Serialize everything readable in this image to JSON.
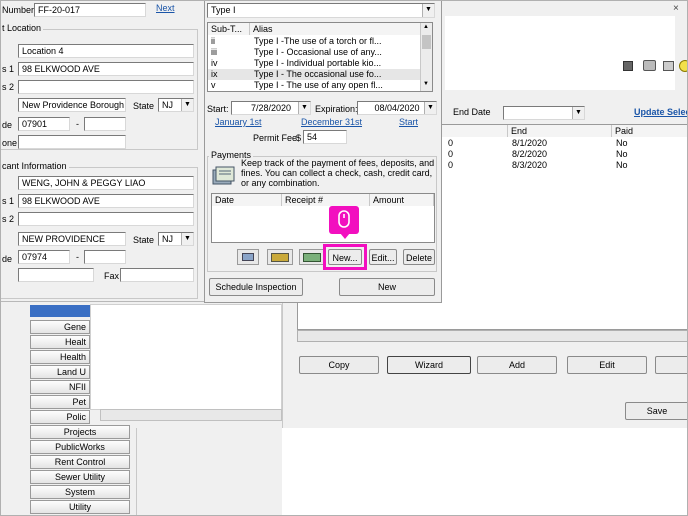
{
  "left_form": {
    "number_label": "Number:",
    "number_value": "FF-20-017",
    "next_link": "Next",
    "location_group": "t Location",
    "location_name": "Location 4",
    "address1_label": "s 1",
    "address1_value": "98 ELKWOOD AVE",
    "address2_label": "s 2",
    "city_value": "New Providence Borough",
    "state_label": "State",
    "state_value": "NJ",
    "zip_label": "de",
    "zip_value": "07901",
    "zip_dash": "-",
    "phone_label": "one",
    "applicant_group": "cant Information",
    "applicant_name": "WENG, JOHN & PEGGY LIAO",
    "app_address1_label": "s 1",
    "app_address1_value": "98 ELKWOOD AVE",
    "app_address2_label": "s 2",
    "app_city_value": "NEW PROVIDENCE",
    "app_state_label": "State",
    "app_state_value": "NJ",
    "app_zip_label": "de",
    "app_zip_value": "07974",
    "app_zip_dash": "-",
    "fax_label": "Fax"
  },
  "permit_panel": {
    "type_value": "Type I",
    "subtype_headers": [
      "Sub-T...",
      "Alias"
    ],
    "subtypes": [
      {
        "code": "ii",
        "alias": "Type I -The use of a torch or fl..."
      },
      {
        "code": "iii",
        "alias": "Type I - Occasional use of any..."
      },
      {
        "code": "iv",
        "alias": "Type I - Individual portable kio..."
      },
      {
        "code": "ix",
        "alias": "Type I - The occasional use fo..."
      },
      {
        "code": "v",
        "alias": "Type I - The use of any open fl..."
      }
    ],
    "start_label": "Start:",
    "start_value": "7/28/2020",
    "expiration_label": "Expiration:",
    "expiration_value": "08/04/2020",
    "link_jan": "January 1st",
    "link_dec": "December 31st",
    "link_start": "Start",
    "permit_fee_label": "Permit Fee",
    "permit_fee_currency": "$",
    "permit_fee_value": "54",
    "payments_title": "Payments",
    "payments_desc": "Keep track of the payment of fees, deposits, and fines. You can collect a check, cash, credit card, or any combination.",
    "payments_headers": [
      "Date",
      "Receipt #",
      "Amount"
    ],
    "new_button": "New...",
    "edit_button": "Edit...",
    "delete_button": "Delete",
    "schedule_button": "Schedule Inspection",
    "new_bottom_button": "New"
  },
  "background_window": {
    "end_date_label": "End Date",
    "update_link": "Update Selec",
    "table_headers": [
      "End",
      "Paid"
    ],
    "rows": [
      {
        "left": "0",
        "end": "8/1/2020",
        "paid": "No"
      },
      {
        "left": "0",
        "end": "8/2/2020",
        "paid": "No"
      },
      {
        "left": "0",
        "end": "8/3/2020",
        "paid": "No"
      }
    ],
    "copy_button": "Copy",
    "wizard_button": "Wizard",
    "add_button": "Add",
    "edit_button": "Edit",
    "save_button": "Save"
  },
  "nav_items": [
    {
      "label": "Gene",
      "cut": true
    },
    {
      "label": "Healt",
      "cut": true
    },
    {
      "label": "Health",
      "cut": true
    },
    {
      "label": "Land U",
      "cut": true
    },
    {
      "label": "NFII",
      "cut": true
    },
    {
      "label": "Pet",
      "cut": true
    },
    {
      "label": "Polic",
      "cut": true
    },
    {
      "label": "Projects",
      "cut": false
    },
    {
      "label": "PublicWorks",
      "cut": false
    },
    {
      "label": "Rent Control",
      "cut": false
    },
    {
      "label": "Sewer Utility",
      "cut": false
    },
    {
      "label": "System",
      "cut": false
    },
    {
      "label": "Utility",
      "cut": false
    }
  ],
  "colors": {
    "highlight": "#f20fbf",
    "link": "#1a55a8",
    "dialog_bg": "#f0f0f0"
  }
}
